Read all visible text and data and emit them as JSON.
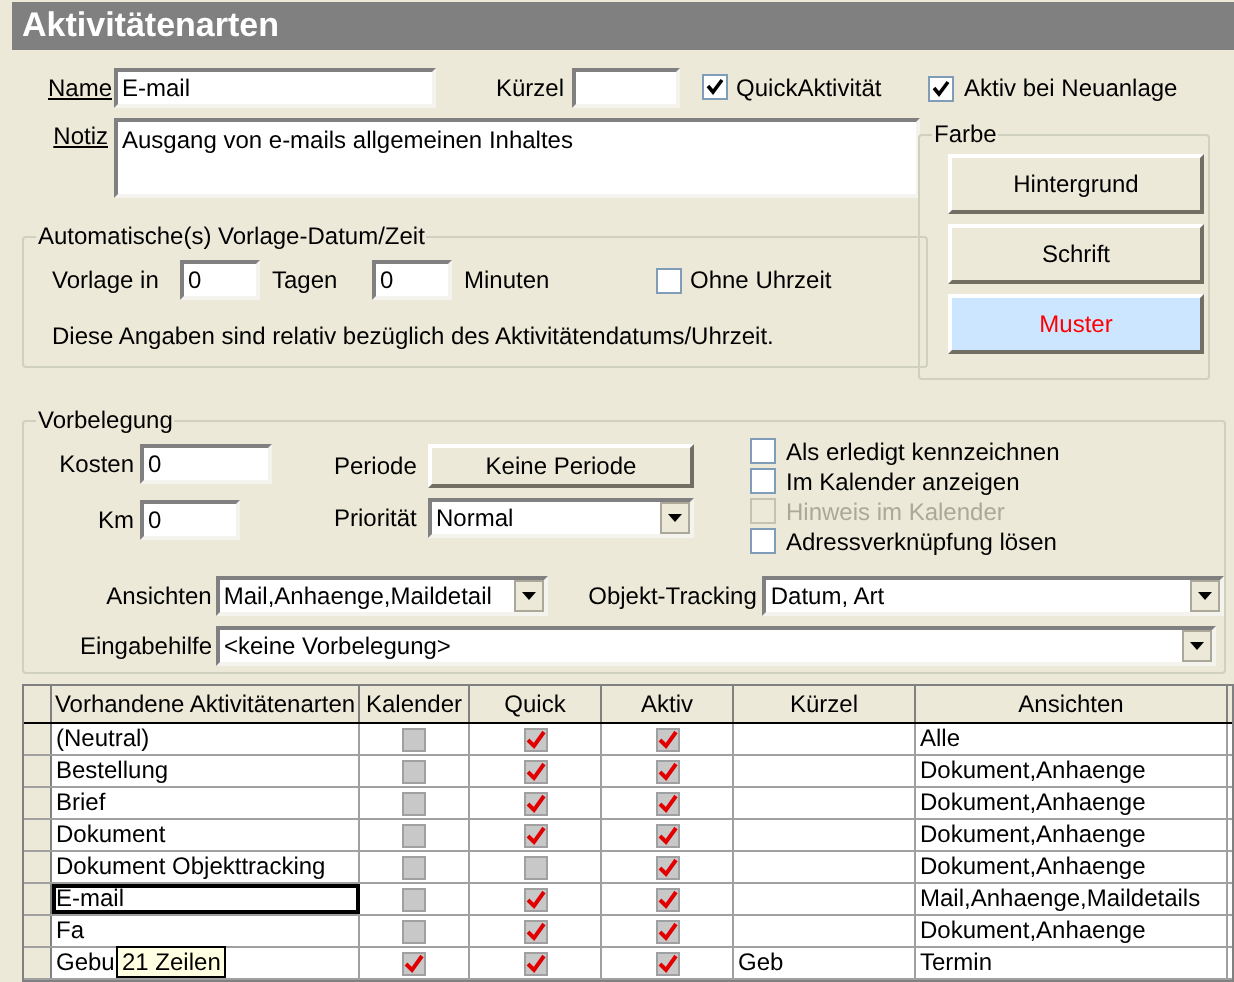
{
  "window": {
    "title": "Aktivitätenarten"
  },
  "name": {
    "label": "Name",
    "value": "E-mail"
  },
  "kuerzel": {
    "label": "Kürzel"
  },
  "quick": {
    "label": "QuickAktivität",
    "checked": true
  },
  "aktiv_neu": {
    "label": "Aktiv bei Neuanlage",
    "checked": true
  },
  "notiz": {
    "label": "Notiz",
    "value": "Ausgang von e-mails allgemeinen Inhaltes"
  },
  "auto": {
    "title": "Automatische(s) Vorlage-Datum/Zeit",
    "vorlage_label": "Vorlage in",
    "tage_value": "0",
    "tage_label": "Tagen",
    "minuten_value": "0",
    "minuten_label": "Minuten",
    "ohne": {
      "label": "Ohne Uhrzeit",
      "checked": false
    },
    "hint": "Diese Angaben sind relativ bezüglich des Aktivitätendatums/Uhrzeit."
  },
  "farbe": {
    "title": "Farbe",
    "buttons": [
      {
        "label": "Hintergrund",
        "selected": false
      },
      {
        "label": "Schrift",
        "selected": false
      },
      {
        "label": "Muster",
        "selected": true
      }
    ]
  },
  "vorbelegung": {
    "title": "Vorbelegung",
    "kosten_label": "Kosten",
    "kosten_value": "0",
    "km_label": "Km",
    "km_value": "0",
    "periode_label": "Periode",
    "periode_button": "Keine Periode",
    "prioritaet_label": "Priorität",
    "prioritaet_value": "Normal",
    "options": [
      {
        "label": "Als erledigt kennzeichnen",
        "checked": false,
        "disabled": false
      },
      {
        "label": "Im Kalender anzeigen",
        "checked": false,
        "disabled": false
      },
      {
        "label": "Hinweis im Kalender",
        "checked": false,
        "disabled": true
      },
      {
        "label": "Adressverknüpfung lösen",
        "checked": false,
        "disabled": false
      }
    ],
    "ansichten_label": "Ansichten",
    "ansichten_value": "Mail,Anhaenge,Maildetail",
    "tracking_label": "Objekt-Tracking",
    "tracking_value": "Datum, Art",
    "eingabe_label": "Eingabehilfe",
    "eingabe_value": "<keine Vorbelegung>"
  },
  "table": {
    "columns": [
      "Vorhandene Aktivitätenarten",
      "Kalender",
      "Quick",
      "Aktiv",
      "Kürzel",
      "Ansichten"
    ],
    "rows": [
      {
        "name": "(Neutral)",
        "kalender": false,
        "quick": true,
        "aktiv": true,
        "kuerzel": "",
        "ansichten": "Alle",
        "selected": false
      },
      {
        "name": "Bestellung",
        "kalender": false,
        "quick": true,
        "aktiv": true,
        "kuerzel": "",
        "ansichten": "Dokument,Anhaenge",
        "selected": false
      },
      {
        "name": "Brief",
        "kalender": false,
        "quick": true,
        "aktiv": true,
        "kuerzel": "",
        "ansichten": "Dokument,Anhaenge",
        "selected": false
      },
      {
        "name": "Dokument",
        "kalender": false,
        "quick": true,
        "aktiv": true,
        "kuerzel": "",
        "ansichten": "Dokument,Anhaenge",
        "selected": false
      },
      {
        "name": "Dokument Objekttracking",
        "kalender": false,
        "quick": false,
        "aktiv": true,
        "kuerzel": "",
        "ansichten": "Dokument,Anhaenge",
        "selected": false
      },
      {
        "name": "E-mail",
        "kalender": false,
        "quick": true,
        "aktiv": true,
        "kuerzel": "",
        "ansichten": "Mail,Anhaenge,Maildetails",
        "selected": true
      },
      {
        "name": "Fa",
        "kalender": false,
        "quick": true,
        "aktiv": true,
        "kuerzel": "",
        "ansichten": "Dokument,Anhaenge",
        "selected": false
      },
      {
        "name": "Gebu",
        "kalender": true,
        "quick": true,
        "aktiv": true,
        "kuerzel": "Geb",
        "ansichten": "Termin",
        "selected": false
      }
    ],
    "tooltip": "21 Zeilen"
  }
}
